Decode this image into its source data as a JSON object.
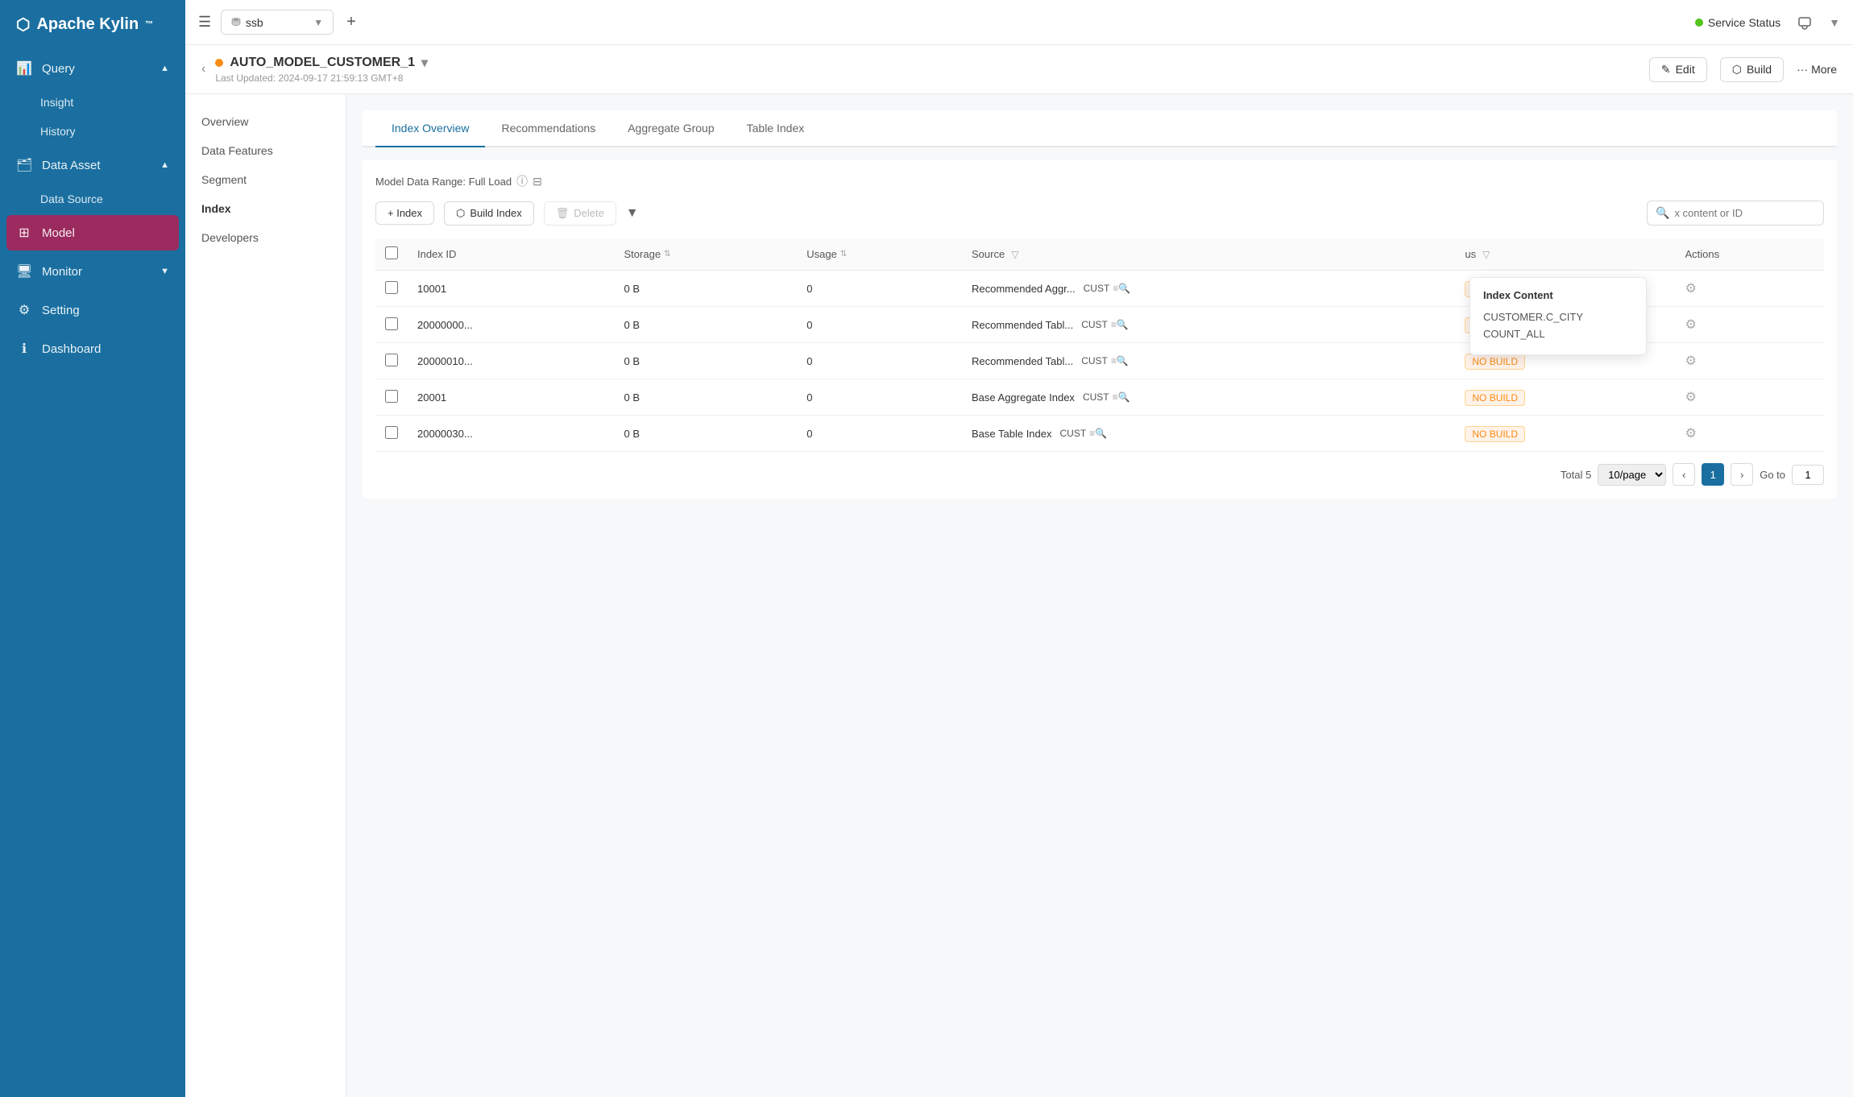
{
  "app": {
    "name": "Apache Kylin",
    "trademark": "™"
  },
  "sidebar": {
    "items": [
      {
        "id": "query",
        "label": "Query",
        "icon": "📊",
        "hasArrow": true,
        "active": false
      },
      {
        "id": "insight",
        "label": "Insight",
        "icon": "",
        "indent": true,
        "active": false
      },
      {
        "id": "history",
        "label": "History",
        "icon": "",
        "indent": true,
        "active": false
      },
      {
        "id": "data-asset",
        "label": "Data Asset",
        "icon": "🗂",
        "hasArrow": true,
        "active": false
      },
      {
        "id": "data-source",
        "label": "Data Source",
        "icon": "",
        "indent": true,
        "active": false
      },
      {
        "id": "model",
        "label": "Model",
        "icon": "",
        "indent": false,
        "active": true
      },
      {
        "id": "monitor",
        "label": "Monitor",
        "icon": "🖥",
        "hasArrow": true,
        "active": false
      },
      {
        "id": "setting",
        "label": "Setting",
        "icon": "⚙",
        "active": false
      },
      {
        "id": "dashboard",
        "label": "Dashboard",
        "icon": "ℹ",
        "active": false
      }
    ]
  },
  "topbar": {
    "db_name": "ssb",
    "service_status": "Service Status",
    "status_color": "#52c41a"
  },
  "model": {
    "name": "AUTO_MODEL_CUSTOMER_1",
    "status_color": "#fa8c16",
    "last_updated": "Last Updated: 2024-09-17 21:59:13 GMT+8",
    "actions": {
      "edit": "Edit",
      "build": "Build",
      "more": "More"
    }
  },
  "left_nav": {
    "items": [
      {
        "id": "overview",
        "label": "Overview",
        "active": false
      },
      {
        "id": "data-features",
        "label": "Data Features",
        "active": false
      },
      {
        "id": "segment",
        "label": "Segment",
        "active": false
      },
      {
        "id": "index",
        "label": "Index",
        "active": true
      },
      {
        "id": "developers",
        "label": "Developers",
        "active": false
      }
    ]
  },
  "tabs": {
    "items": [
      {
        "id": "index-overview",
        "label": "Index Overview",
        "active": true
      },
      {
        "id": "recommendations",
        "label": "Recommendations",
        "active": false
      },
      {
        "id": "aggregate-group",
        "label": "Aggregate Group",
        "active": false
      },
      {
        "id": "table-index",
        "label": "Table Index",
        "active": false
      }
    ]
  },
  "index_panel": {
    "data_range_label": "Model Data Range: Full Load",
    "toolbar": {
      "add_index": "+ Index",
      "build_index": "Build Index",
      "delete": "Delete",
      "search_placeholder": "x content or ID"
    },
    "columns": [
      {
        "id": "index-id",
        "label": "Index ID"
      },
      {
        "id": "storage",
        "label": "Storage"
      },
      {
        "id": "usage",
        "label": "Usage"
      },
      {
        "id": "source",
        "label": "Source"
      },
      {
        "id": "status",
        "label": "us"
      },
      {
        "id": "actions",
        "label": "Actions"
      }
    ],
    "rows": [
      {
        "id": "10001",
        "storage": "0 B",
        "usage": "0",
        "source": "Recommended Aggr...",
        "source_abbr": "CUST",
        "status": "NO BUILD"
      },
      {
        "id": "20000000...",
        "storage": "0 B",
        "usage": "0",
        "source": "Recommended Tabl...",
        "source_abbr": "CUST",
        "status": "NO BUILD"
      },
      {
        "id": "20000010...",
        "storage": "0 B",
        "usage": "0",
        "source": "Recommended Tabl...",
        "source_abbr": "CUST",
        "status": "NO BUILD"
      },
      {
        "id": "20001",
        "storage": "0 B",
        "usage": "0",
        "source": "Base Aggregate Index",
        "source_abbr": "CUST",
        "status": "NO BUILD"
      },
      {
        "id": "20000030...",
        "storage": "0 B",
        "usage": "0",
        "source": "Base Table Index",
        "source_abbr": "CUST",
        "status": "NO BUILD"
      }
    ],
    "pagination": {
      "total": "Total 5",
      "per_page": "10/page",
      "current_page": "1",
      "goto_label": "Go to",
      "goto_page": "1"
    },
    "popup": {
      "title": "Index Content",
      "items": [
        "CUSTOMER.C_CITY",
        "COUNT_ALL"
      ]
    }
  }
}
